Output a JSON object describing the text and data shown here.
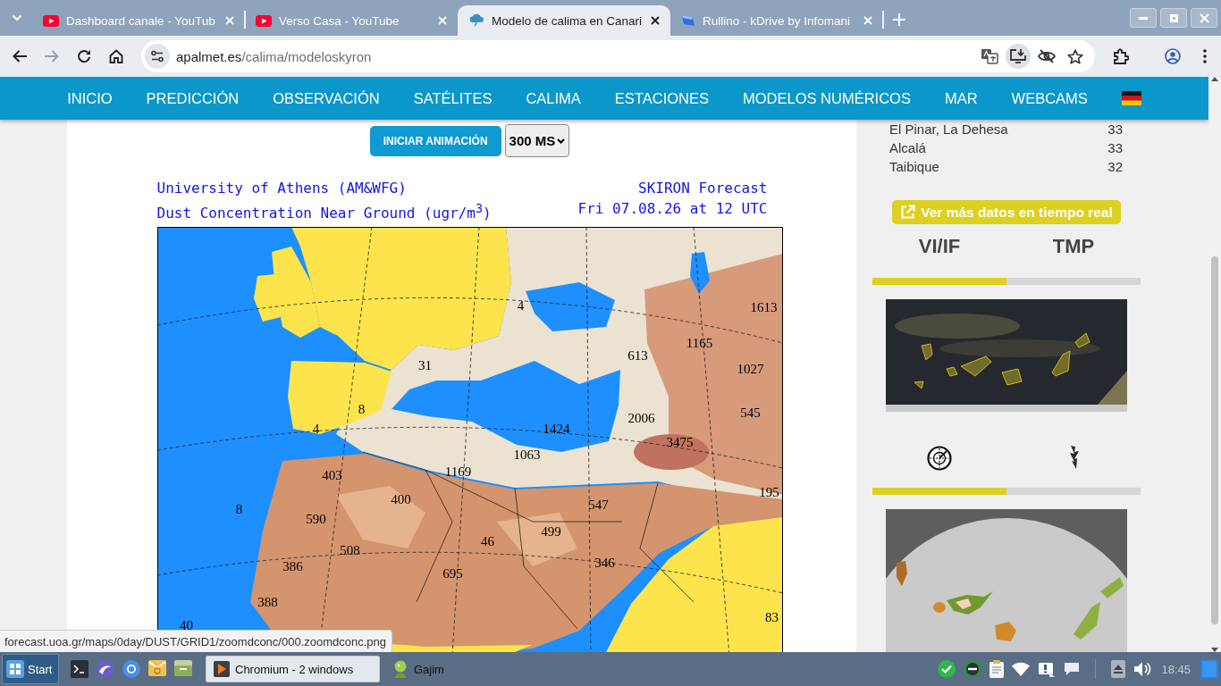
{
  "browser": {
    "tabs": [
      {
        "kind": "video",
        "title": "Dashboard canale - YouTub",
        "selected": false
      },
      {
        "kind": "video",
        "title": "Verso Casa - YouTube",
        "selected": false
      },
      {
        "kind": "weather",
        "title": "Modelo de calima en Canari",
        "selected": true
      },
      {
        "kind": "drive",
        "title": "Rullino - kDrive by Infomani",
        "selected": false
      }
    ],
    "address": {
      "host": "apalmet.es",
      "path": "/calima/modeloskyron"
    },
    "status_url": "forecast.uoa.gr/maps/0day/DUST/GRID1/zoomdconc/000.zoomdconc.png"
  },
  "nav": {
    "items": [
      "INICIO",
      "PREDICCIÓN",
      "OBSERVACIÓN",
      "SATÉLITES",
      "CALIMA",
      "ESTACIONES",
      "MODELOS NUMÉRICOS",
      "MAR",
      "WEBCAMS"
    ]
  },
  "animation": {
    "button": "INICIAR ANIMACIÓN",
    "speed": "300 MS"
  },
  "map": {
    "header_left": [
      "University of Athens (AM&WFG)",
      "Dust Concentration Near Ground (ugr/m$^{3}$)"
    ],
    "header_right": [
      "SKIRON Forecast",
      "Fri 07.08.26 at 12 UTC"
    ],
    "labels": [
      "4",
      "1613",
      "1165",
      "613",
      "31",
      "1027",
      "8",
      "545",
      "2006",
      "4",
      "1424",
      "3475",
      "1063",
      "1169",
      "403",
      "195",
      "400",
      "547",
      "8",
      "590",
      "499",
      "46",
      "508",
      "346",
      "386",
      "695",
      "388",
      "83",
      "40"
    ]
  },
  "sidebar": {
    "rows": [
      {
        "place": "El Pinar, La Dehesa",
        "value": "33"
      },
      {
        "place": "Alcalá",
        "value": "33"
      },
      {
        "place": "Taibique",
        "value": "32"
      }
    ],
    "button": "Ver más datos en tiempo real",
    "tabs": [
      {
        "label": "VI/IF",
        "selected": true
      },
      {
        "label": "TMP",
        "selected": false
      }
    ],
    "icon_tabs": [
      {
        "kind": "radar",
        "selected": true
      },
      {
        "kind": "lightning",
        "selected": false
      }
    ]
  },
  "taskbar": {
    "start": "Start",
    "tasks": [
      {
        "kind": "browser",
        "label": "Chromium - 2 windows",
        "selected": true
      },
      {
        "kind": "chat",
        "label": "Gajim",
        "selected": false
      }
    ],
    "clock": "18:45"
  }
}
